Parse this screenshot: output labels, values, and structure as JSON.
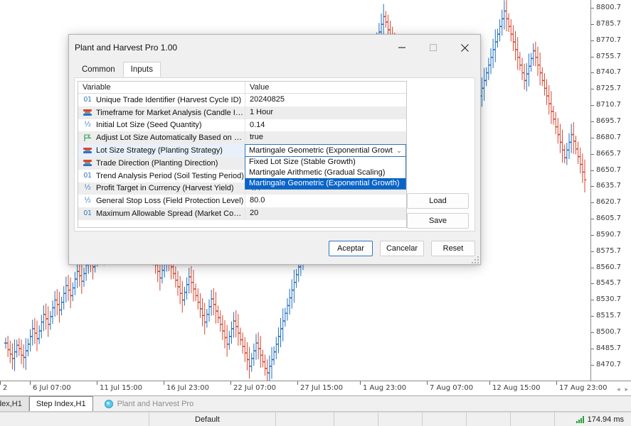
{
  "dialog": {
    "title": "Plant and Harvest Pro 1.00",
    "window_buttons": [
      {
        "name": "minimize",
        "glyph": "minimize-icon"
      },
      {
        "name": "maximize",
        "glyph": "maximize-icon"
      },
      {
        "name": "close",
        "glyph": "close-icon"
      }
    ],
    "tabs": [
      {
        "label": "Common",
        "active": false
      },
      {
        "label": "Inputs",
        "active": true
      }
    ],
    "table": {
      "headers": {
        "variable": "Variable",
        "value": "Value"
      },
      "rows": [
        {
          "icon": "integer-type-icon",
          "type": "int",
          "variable": "Unique Trade Identifier (Harvest Cycle ID)",
          "value": "20240825"
        },
        {
          "icon": "enum-type-icon",
          "type": "enum",
          "variable": "Timeframe for Market Analysis (Candle Interval)",
          "value": "1 Hour"
        },
        {
          "icon": "double-type-icon",
          "type": "dbl",
          "variable": "Initial Lot Size (Seed Quantity)",
          "value": "0.14"
        },
        {
          "icon": "boolean-type-icon",
          "type": "flag",
          "variable": "Adjust Lot Size Automatically Based on Balance?...",
          "value": "true"
        },
        {
          "icon": "enum-type-icon",
          "type": "enum",
          "variable": "Lot Size Strategy (Planting Strategy)",
          "value": "Martingale Geometric (Exponential Growth)",
          "editing": true
        },
        {
          "icon": "enum-type-icon",
          "type": "enum",
          "variable": "Trade Direction (Planting Direction)",
          "value": ""
        },
        {
          "icon": "integer-type-icon",
          "type": "int",
          "variable": "Trend Analysis Period (Soil Testing Period)",
          "value": ""
        },
        {
          "icon": "double-type-icon",
          "type": "dbl",
          "variable": "Profit Target in Currency (Harvest Yield)",
          "value": "4.4"
        },
        {
          "icon": "double-type-icon",
          "type": "dbl",
          "variable": "General Stop Loss (Field Protection Level)",
          "value": "80.0"
        },
        {
          "icon": "integer-type-icon",
          "type": "int",
          "variable": "Maximum Allowable Spread (Market Condition T...",
          "value": "20"
        }
      ]
    },
    "dropdown": {
      "selected": "Martingale Geometric (Exponential Growth)",
      "options": [
        {
          "label": "Fixed Lot Size (Stable Growth)",
          "selected": false
        },
        {
          "label": "Martingale Arithmetic (Gradual Scaling)",
          "selected": false
        },
        {
          "label": "Martingale Geometric (Exponential Growth)",
          "selected": true
        }
      ],
      "highlight_color": "#0a64c8"
    },
    "side_buttons": [
      {
        "label": "Load"
      },
      {
        "label": "Save"
      }
    ],
    "footer_buttons": [
      {
        "label": "Aceptar",
        "default": true
      },
      {
        "label": "Cancelar",
        "default": false
      },
      {
        "label": "Reset",
        "default": false
      }
    ]
  },
  "chart": {
    "price_axis": [
      "8800.7",
      "8785.7",
      "8770.7",
      "8755.7",
      "8740.7",
      "8725.7",
      "8710.7",
      "8695.7",
      "8680.7",
      "8665.7",
      "8650.7",
      "8635.7",
      "8620.7",
      "8605.7",
      "8590.7",
      "8575.7",
      "8560.7",
      "8545.7",
      "8530.7",
      "8515.7",
      "8500.7",
      "8485.7",
      "8470.7"
    ],
    "time_axis": [
      {
        "label": "2",
        "x": 0
      },
      {
        "label": "6 Jul 07:00",
        "x": 42
      },
      {
        "label": "11 Jul 15:00",
        "x": 136
      },
      {
        "label": "16 Jul 23:00",
        "x": 230
      },
      {
        "label": "22 Jul 07:00",
        "x": 324
      },
      {
        "label": "27 Jul 15:00",
        "x": 418
      },
      {
        "label": "1 Aug 23:00",
        "x": 506
      },
      {
        "label": "7 Aug 07:00",
        "x": 600
      },
      {
        "label": "12 Aug 15:00",
        "x": 688
      },
      {
        "label": "17 Aug 23:00",
        "x": 782
      }
    ],
    "scroll_arrows": {
      "left": "◂",
      "right": "▸"
    },
    "bull_color": "#1f6fc4",
    "bear_color": "#d8452f"
  },
  "chart_data": {
    "type": "line",
    "title": "",
    "xlabel": "",
    "ylabel": "",
    "ylim": [
      8463,
      8808
    ],
    "series": [
      {
        "name": "Step Index H1",
        "points": [
          8497,
          8491,
          8487,
          8483,
          8489,
          8495,
          8492,
          8486,
          8484,
          8490,
          8496,
          8503,
          8510,
          8506,
          8501,
          8508,
          8516,
          8523,
          8519,
          8514,
          8521,
          8529,
          8536,
          8532,
          8527,
          8534,
          8542,
          8549,
          8545,
          8540,
          8547,
          8555,
          8562,
          8558,
          8553,
          8560,
          8568,
          8575,
          8571,
          8566,
          8573,
          8581,
          8588,
          8584,
          8579,
          8586,
          8594,
          8601,
          8597,
          8592,
          8599,
          8607,
          8614,
          8610,
          8605,
          8612,
          8620,
          8627,
          8623,
          8618,
          8611,
          8604,
          8598,
          8592,
          8586,
          8580,
          8574,
          8568,
          8562,
          8556,
          8563,
          8570,
          8577,
          8572,
          8566,
          8560,
          8554,
          8548,
          8542,
          8536,
          8543,
          8550,
          8557,
          8552,
          8546,
          8540,
          8534,
          8528,
          8522,
          8516,
          8523,
          8530,
          8537,
          8532,
          8526,
          8520,
          8514,
          8508,
          8502,
          8496,
          8503,
          8510,
          8517,
          8512,
          8506,
          8500,
          8494,
          8488,
          8482,
          8476,
          8483,
          8490,
          8497,
          8492,
          8486,
          8480,
          8474,
          8470,
          8476,
          8482,
          8489,
          8496,
          8503,
          8510,
          8517,
          8524,
          8531,
          8538,
          8545,
          8552,
          8559,
          8566,
          8573,
          8580,
          8587,
          8594,
          8601,
          8608,
          8615,
          8622,
          8629,
          8636,
          8643,
          8650,
          8657,
          8664,
          8671,
          8678,
          8685,
          8692,
          8699,
          8706,
          8713,
          8720,
          8727,
          8734,
          8741,
          8748,
          8755,
          8762,
          8757,
          8750,
          8744,
          8751,
          8758,
          8765,
          8772,
          8779,
          8786,
          8793,
          8788,
          8781,
          8774,
          8767,
          8760,
          8753,
          8746,
          8739,
          8732,
          8725,
          8718,
          8711,
          8717,
          8724,
          8731,
          8726,
          8719,
          8712,
          8705,
          8711,
          8718,
          8725,
          8732,
          8739,
          8734,
          8727,
          8720,
          8713,
          8719,
          8726,
          8733,
          8740,
          8747,
          8742,
          8735,
          8728,
          8721,
          8714,
          8707,
          8700,
          8707,
          8714,
          8721,
          8728,
          8735,
          8742,
          8749,
          8756,
          8763,
          8770,
          8777,
          8784,
          8791,
          8798,
          8791,
          8784,
          8777,
          8770,
          8763,
          8756,
          8749,
          8742,
          8735,
          8741,
          8748,
          8755,
          8762,
          8756,
          8749,
          8742,
          8735,
          8728,
          8721,
          8714,
          8707,
          8700,
          8693,
          8686,
          8679,
          8672,
          8665,
          8672,
          8679,
          8686,
          8680,
          8673,
          8666,
          8659,
          8652,
          8645
        ]
      }
    ]
  },
  "taskbar": {
    "tabs": [
      {
        "label": "dex,H1",
        "active": false,
        "partial": true
      },
      {
        "label": "Step Index,H1",
        "active": true,
        "partial": false
      }
    ],
    "ea_chip": {
      "label": "Plant and Harvest Pro",
      "icon": "expert-advisor-icon"
    }
  },
  "status": {
    "profile": "Default",
    "ping": "174.94 ms",
    "ping_icon": "signal-bars-icon"
  }
}
